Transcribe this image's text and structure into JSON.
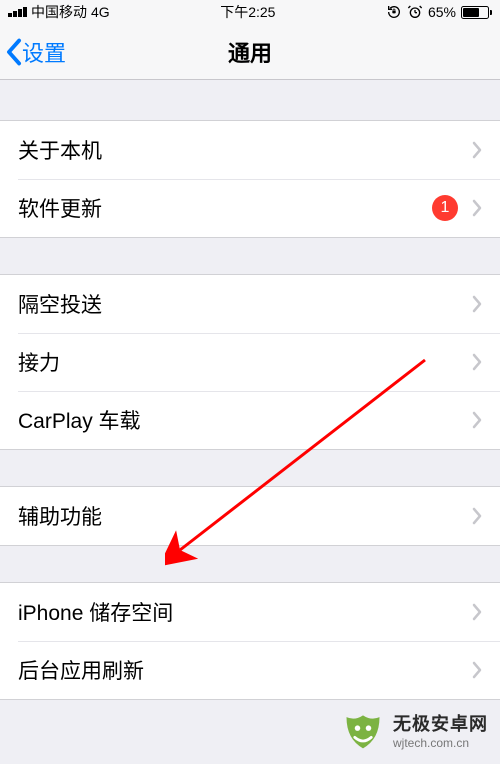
{
  "status_bar": {
    "carrier": "中国移动",
    "network": "4G",
    "time": "下午2:25",
    "battery_pct": "65%"
  },
  "nav": {
    "back": "设置",
    "title": "通用"
  },
  "groups": [
    {
      "items": [
        {
          "key": "about",
          "label": "关于本机",
          "badge": null
        },
        {
          "key": "software-update",
          "label": "软件更新",
          "badge": "1"
        }
      ]
    },
    {
      "items": [
        {
          "key": "airdrop",
          "label": "隔空投送",
          "badge": null
        },
        {
          "key": "handoff",
          "label": "接力",
          "badge": null
        },
        {
          "key": "carplay",
          "label": "CarPlay 车载",
          "badge": null
        }
      ]
    },
    {
      "items": [
        {
          "key": "accessibility",
          "label": "辅助功能",
          "badge": null
        }
      ]
    },
    {
      "items": [
        {
          "key": "iphone-storage",
          "label": "iPhone 储存空间",
          "badge": null
        },
        {
          "key": "background-refresh",
          "label": "后台应用刷新",
          "badge": null
        }
      ]
    }
  ],
  "watermark": {
    "title": "无极安卓网",
    "sub": "wjtech.com.cn"
  },
  "icons": {
    "alarm": "⏰",
    "lock_rotate": "🔒"
  }
}
